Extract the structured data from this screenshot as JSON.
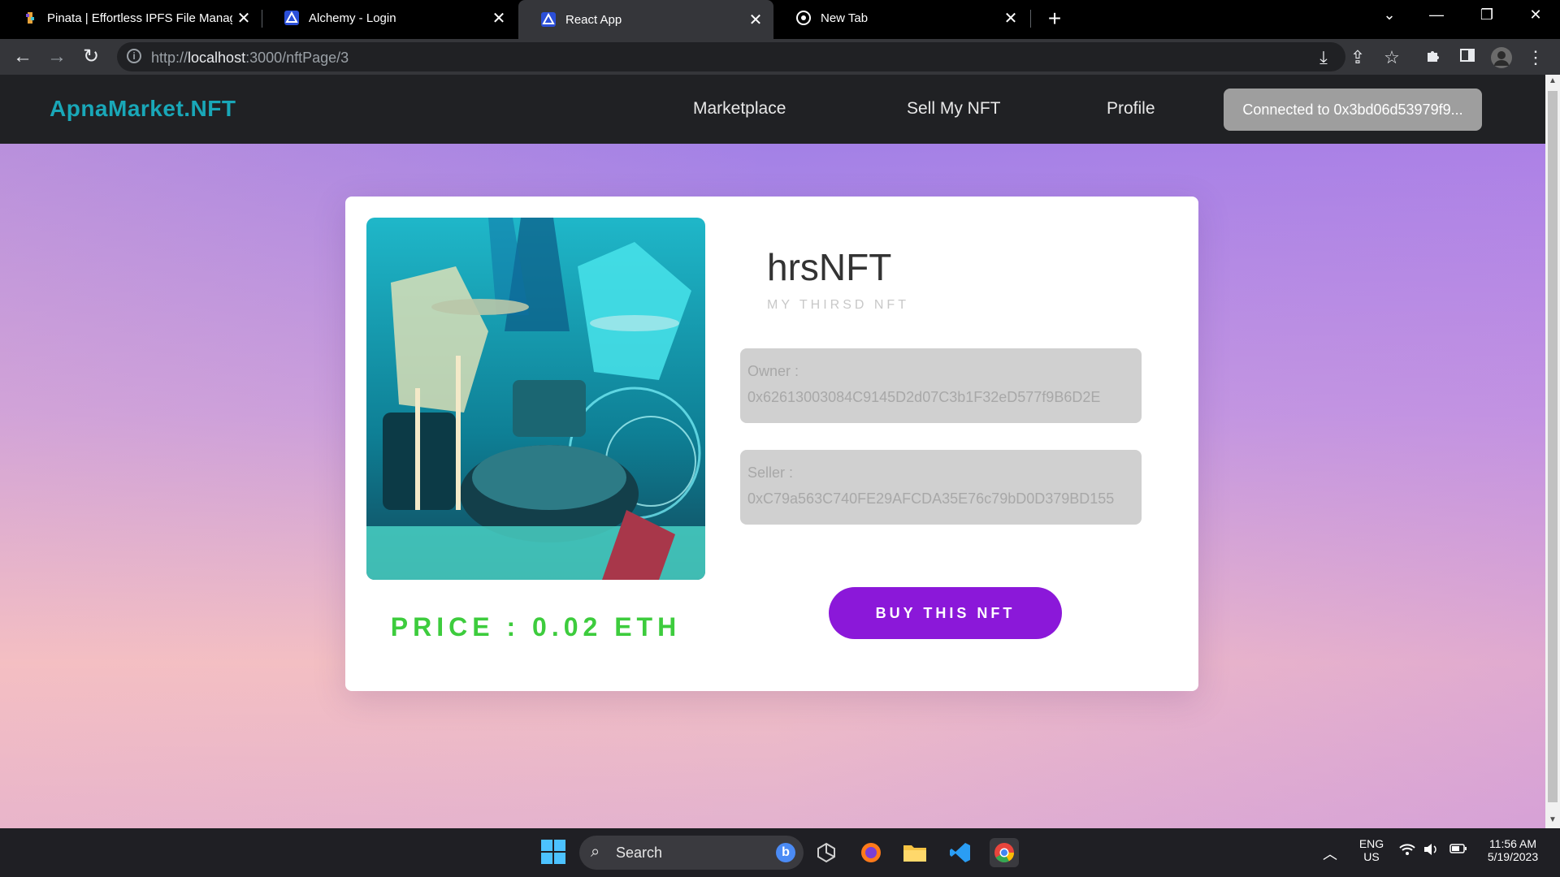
{
  "browser": {
    "tabs": [
      {
        "title": "Pinata | Effortless IPFS File Management"
      },
      {
        "title": "Alchemy - Login"
      },
      {
        "title": "React App"
      },
      {
        "title": "New Tab"
      }
    ],
    "url_prefix": "http://",
    "url_host": "localhost",
    "url_path": ":3000/nftPage/3"
  },
  "app": {
    "brand": "ApnaMarket.NFT",
    "nav": {
      "marketplace": "Marketplace",
      "sell": "Sell My NFT",
      "profile": "Profile"
    },
    "connect_label": "Connected to 0x3bd06d53979f9..."
  },
  "nft": {
    "name": "hrsNFT",
    "description": "MY THIRSD NFT",
    "owner_label": "Owner :",
    "owner": "0x62613003084C9145D2d07C3b1F32eD577f9B6D2E",
    "seller_label": "Seller :",
    "seller": "0xC79a563C740FE29AFCDA35E76c79bD0D379BD155",
    "price": "PRICE : 0.02 ETH",
    "buy_label": "BUY THIS NFT"
  },
  "taskbar": {
    "search_label": "Search",
    "lang": "ENG",
    "region": "US",
    "time": "11:56 AM",
    "date": "5/19/2023"
  },
  "colors": {
    "brand": "#19a7b8",
    "price": "#3dcc3d",
    "buy_button": "#8b18d9",
    "info_box": "#d0d0d0"
  }
}
